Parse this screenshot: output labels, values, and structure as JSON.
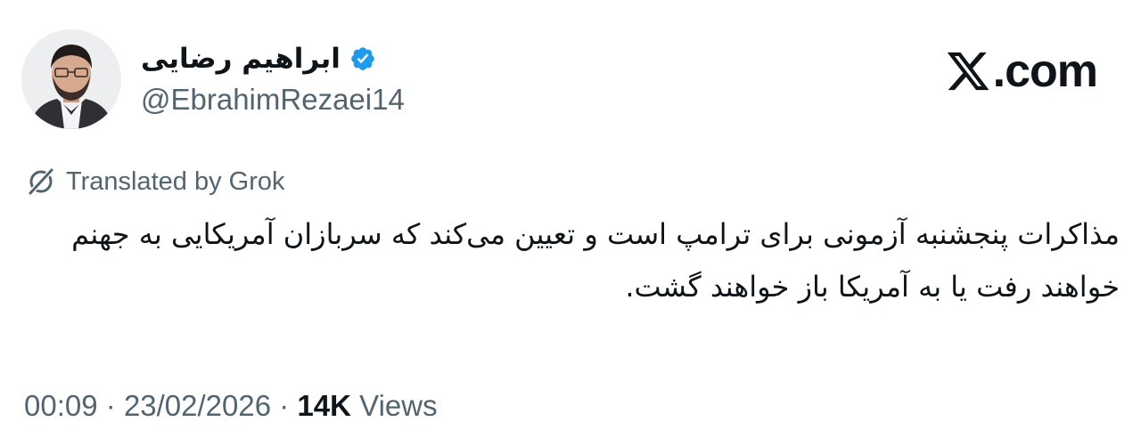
{
  "author": {
    "display_name": "ابراهیم رضایی",
    "handle": "@EbrahimRezaei14",
    "verified": true,
    "verified_color": "#1d9bf0"
  },
  "brand": {
    "text": ".com",
    "icon": "x-logo-icon"
  },
  "translation": {
    "label": "Translated by Grok",
    "icon": "grok-icon"
  },
  "tweet": {
    "text": "مذاکرات پنجشنبه آزمونی برای ترامپ است و تعیین می‌کند که سربازان آمریکایی به جهنم خواهند رفت یا به آمریکا باز خواهند گشت."
  },
  "meta": {
    "time": "00:09",
    "separator": "·",
    "date": "23/02/2026",
    "views_count": "14K",
    "views_label": "Views"
  },
  "colors": {
    "text_primary": "#0f1419",
    "text_secondary": "#536471",
    "verified_blue": "#1d9bf0"
  }
}
